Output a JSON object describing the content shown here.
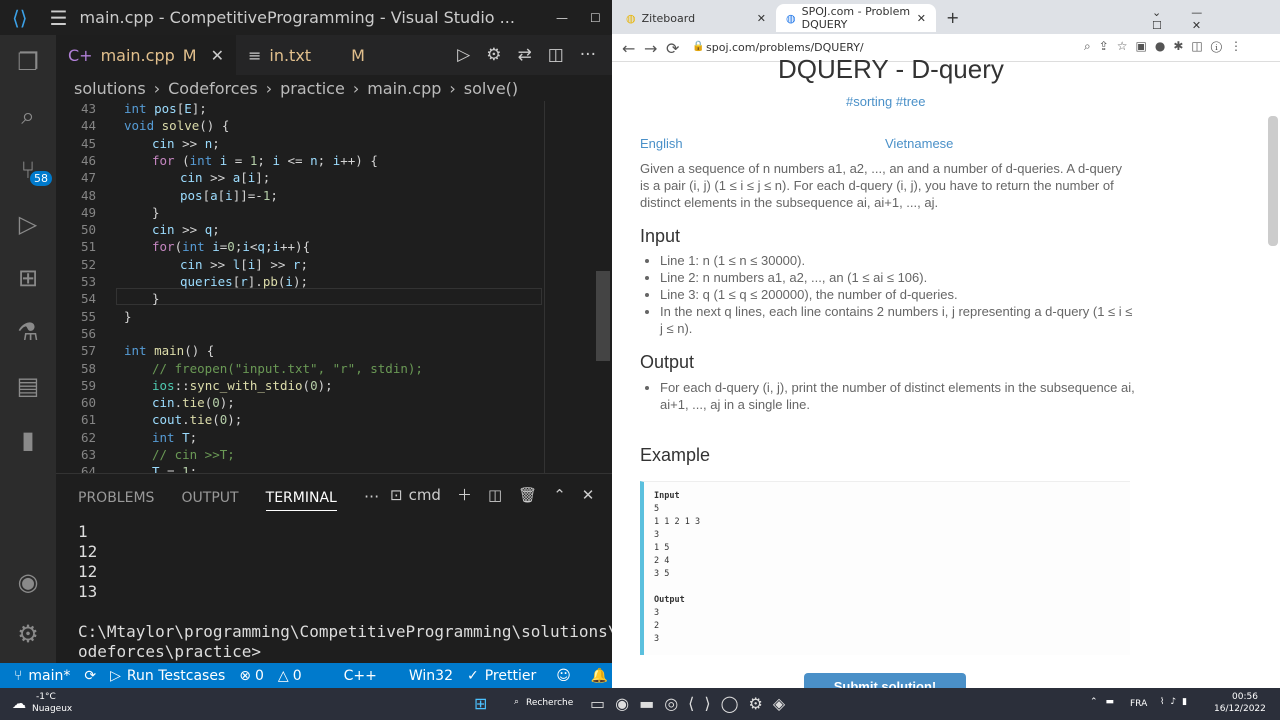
{
  "vscode": {
    "window_title": "main.cpp - CompetitiveProgramming - Visual Studio ...",
    "tabs": [
      {
        "label": "main.cpp",
        "badge": "M"
      },
      {
        "label": "in.txt",
        "badge": "M"
      }
    ],
    "breadcrumb": [
      "solutions",
      "Codeforces",
      "practice",
      "main.cpp",
      "solve()"
    ],
    "activity_badge": "58",
    "line_numbers": [
      "43",
      "44",
      "45",
      "46",
      "47",
      "48",
      "49",
      "50",
      "51",
      "52",
      "53",
      "54",
      "55",
      "56",
      "57",
      "58",
      "59",
      "60",
      "61",
      "62",
      "63",
      "64"
    ],
    "panel_tabs": [
      "PROBLEMS",
      "OUTPUT",
      "TERMINAL"
    ],
    "terminal_label": "cmd",
    "terminal_lines": [
      "1",
      "12",
      "12",
      "13",
      "",
      "C:\\Mtaylor\\programming\\CompetitiveProgramming\\solutions\\C",
      "odeforces\\practice>"
    ],
    "status": {
      "branch": "main*",
      "run": "Run Testcases",
      "errors": "0",
      "warnings": "0",
      "lang": "C++",
      "platform": "Win32",
      "prettier": "Prettier"
    }
  },
  "browser": {
    "tabs": [
      "Ziteboard",
      "SPOJ.com - Problem DQUERY"
    ],
    "url": "spoj.com/problems/DQUERY/",
    "title": "DQUERY - D-query",
    "tags": "#sorting #tree",
    "lang_tabs": [
      "English",
      "Vietnamese"
    ],
    "description": "Given a sequence of n numbers a1, a2, ..., an and a number of d-queries. A d-query is a pair (i, j) (1 ≤ i ≤ j ≤ n). For each d-query (i, j), you have to return the number of distinct elements in the subsequence ai, ai+1, ..., aj.",
    "input_heading": "Input",
    "input_items": [
      "Line 1: n (1 ≤ n ≤ 30000).",
      "Line 2: n numbers a1, a2, ..., an (1 ≤ ai ≤ 106).",
      "Line 3: q (1 ≤ q ≤ 200000), the number of d-queries.",
      "In the next q lines, each line contains 2 numbers i, j representing a d-query (1 ≤ i ≤ j ≤ n)."
    ],
    "output_heading": "Output",
    "output_items": [
      "For each d-query (i, j), print the number of distinct elements in the subsequence ai, ai+1, ..., aj in a single line."
    ],
    "example_heading": "Example",
    "example_input_label": "Input",
    "example_input": [
      "5",
      "1 1 2 1 3",
      "3",
      "1 5",
      "2 4",
      "3 5"
    ],
    "example_output_label": "Output",
    "example_output": [
      "3",
      "2",
      "3"
    ],
    "submit": "Submit solution!"
  },
  "taskbar": {
    "weather_temp": "-1°C",
    "weather_desc": "Nuageux",
    "search": "Recherche",
    "lang": "FRA",
    "time": "00:56",
    "date": "16/12/2022"
  }
}
